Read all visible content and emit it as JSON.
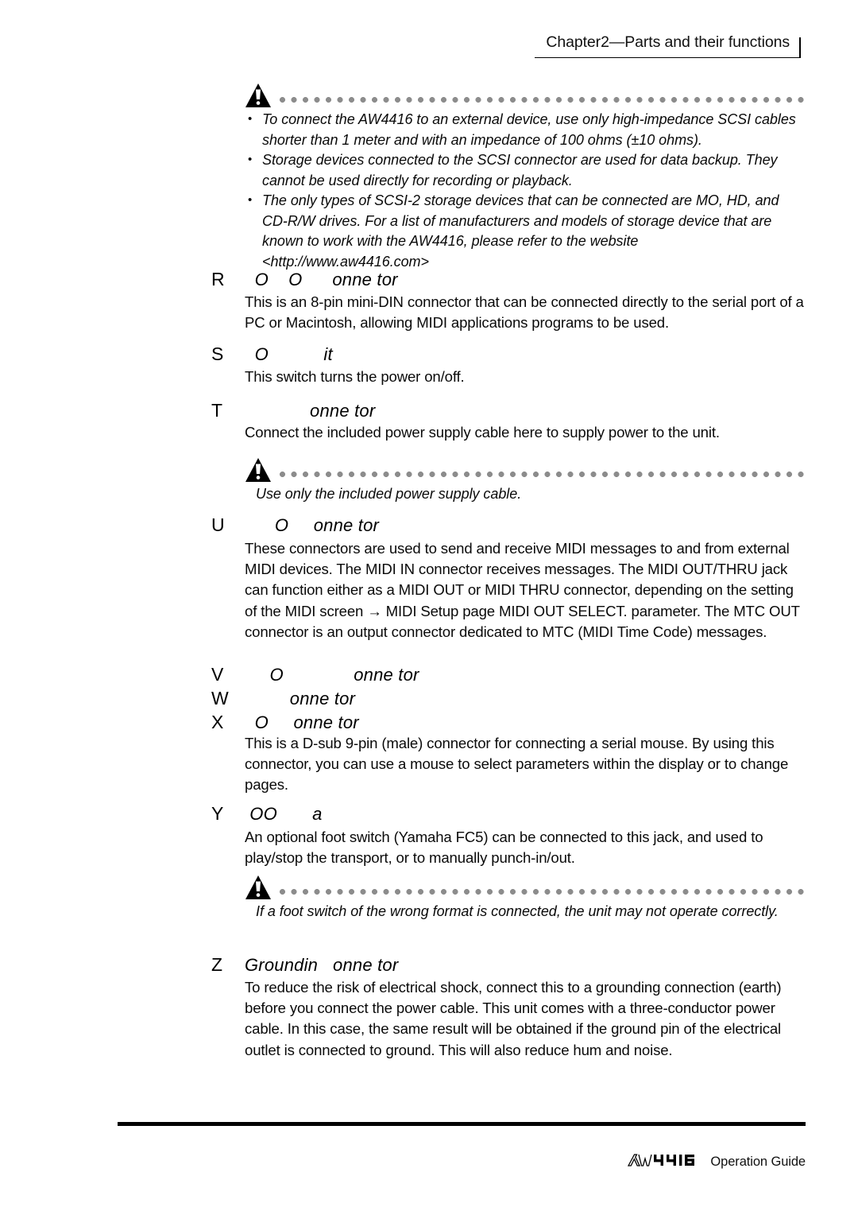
{
  "header": {
    "title": "Chapter2—Parts and their functions"
  },
  "caution_scsi": {
    "icon": "warning-triangle-icon",
    "items": [
      "To connect the AW4416 to an external device, use only high-impedance SCSI cables shorter than 1 meter and with an impedance of 100 ohms (±10 ohms).",
      "Storage devices connected to the SCSI connector are used for data backup. They cannot be used directly for recording or playback.",
      "The only types of SCSI-2 storage devices that can be connected are MO, HD, and CD-R/W drives. For a list of manufacturers and models of storage device that are known to work with the AW4416, please refer to the website <http://www.aw4416.com>"
    ]
  },
  "sections": [
    {
      "letter": "R",
      "label": "  O    O      onne tor",
      "body": "This is an 8-pin mini-DIN connector that can be connected directly to the serial port of a PC or Macintosh, allowing MIDI applications programs to be used."
    },
    {
      "letter": "S",
      "label": "  O           it",
      "body": "This switch turns the power on/off."
    },
    {
      "letter": "T",
      "label": "             onne tor",
      "body": "Connect the included power supply cable here to supply power to the unit."
    },
    {
      "letter": "U",
      "label": "      O     onne tor",
      "body": "These connectors are used to send and receive MIDI messages to and from external MIDI devices. The MIDI IN connector receives messages. The MIDI OUT/THRU jack can function either as a MIDI OUT or MIDI THRU connector, depending on the setting of the MIDI screen → MIDI Setup page MIDI OUT SELECT. parameter. The MTC OUT connector is an output connector dedicated to MTC (MIDI Time Code) messages."
    },
    {
      "letter": "V",
      "label": "     O              onne tor",
      "body": ""
    },
    {
      "letter": "W",
      "label": "         onne tor",
      "body": ""
    },
    {
      "letter": "X",
      "label": "  O     onne tor",
      "body": "This is a D-sub 9-pin (male) connector for connecting a serial mouse. By using this connector, you can use a mouse to select parameters within the display or to change pages."
    },
    {
      "letter": "Y",
      "label": " OO       a",
      "body": "An optional foot switch (Yamaha FC5) can be connected to this jack, and used to play/stop the transport, or to manually punch-in/out."
    },
    {
      "letter": "Z",
      "label": "Groundin   onne tor",
      "body": "To reduce the risk of electrical shock, connect this to a grounding connection (earth) before you connect the power cable. This unit comes with a three-conductor power cable. In this case, the same result will be obtained if the ground pin of the electrical outlet is connected to ground. This will also reduce hum and noise."
    }
  ],
  "caution_power": {
    "icon": "warning-triangle-icon",
    "text": "Use only the included power supply cable."
  },
  "caution_footsw": {
    "icon": "warning-triangle-icon",
    "text": "If a foot switch of the wrong format is connected, the unit may not operate correctly."
  },
  "footer": {
    "logo": "aw4416-logo",
    "text": "Operation Guide"
  },
  "colors": {
    "text": "#0a0a0a",
    "dots": "#8c8c8c",
    "rule": "#000000"
  }
}
